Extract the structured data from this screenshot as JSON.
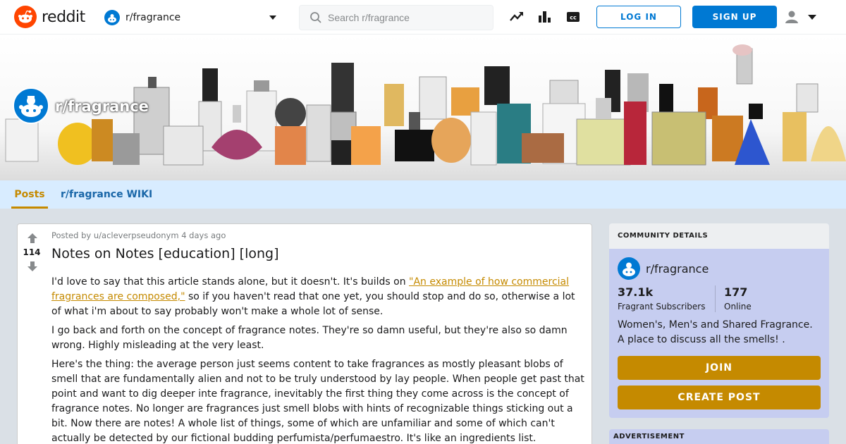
{
  "header": {
    "logo_text": "reddit",
    "community_selector": "r/fragrance",
    "search_placeholder": "Search r/fragrance",
    "login_label": "LOG IN",
    "signup_label": "SIGN UP",
    "icons": [
      "reddit-logo-icon",
      "trending-icon",
      "stats-icon",
      "captions-icon",
      "user-icon",
      "chevron-down-icon"
    ]
  },
  "banner": {
    "community_title": "r/fragrance"
  },
  "nav": {
    "tabs": [
      {
        "label": "Posts",
        "active": true
      },
      {
        "label": "r/fragrance WIKI",
        "active": false
      }
    ]
  },
  "post": {
    "votes": "114",
    "meta": "Posted by u/acleverpseudonym 4 days ago",
    "title": "Notes on Notes [education] [long]",
    "p1_before": "I'd love to say that this article stands alone, but it doesn't. It's builds on ",
    "p1_link": "\"An example of how commercial fragrances are composed,\"",
    "p1_after": " so if you haven't read that one yet, you should stop and do so, otherwise a lot of what i'm about to say probably won't make a whole lot of sense.",
    "p2": "I go back and forth on the concept of fragrance notes. They're so damn useful, but they're also so damn wrong. Highly misleading at the very least.",
    "p3": "Here's the thing: the average person just seems content to take fragrances as mostly pleasant blobs of smell that are fundamentally alien and not to be truly understood by lay people. When people get past that point and want to dig deeper inte fragrance, inevitably the first thing they come across is the concept of fragrance notes. No longer are fragrances just smell blobs with hints of recognizable things sticking out a bit. Now there are notes! A whole list of things, some of which are unfamiliar and some of which can't actually be detected by our fictional budding perfumista/perfumaestro. It's like an ingredients list."
  },
  "sidebar": {
    "header": "COMMUNITY DETAILS",
    "community_name": "r/fragrance",
    "subscribers_value": "37.1k",
    "subscribers_label": "Fragrant Subscribers",
    "online_value": "177",
    "online_label": "Online",
    "description": "Women's, Men's and Shared Fragrance. A place to discuss all the smells! .",
    "join_label": "JOIN",
    "create_post_label": "CREATE POST",
    "advertisement_label": "ADVERTISEMENT"
  },
  "colors": {
    "accent": "#c58a00",
    "primary_blue": "#0079d3",
    "reddit_orange": "#ff4500",
    "nav_background": "#d8ecff",
    "sidebar_background": "#c6cdf0"
  }
}
